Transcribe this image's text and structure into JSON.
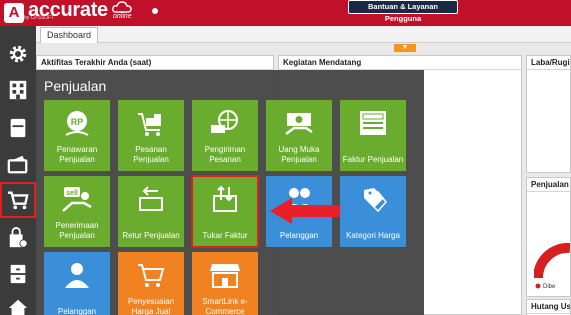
{
  "app": {
    "brand": "accurate",
    "brand_sub": "by CPSSOFT",
    "brand_edition": "online",
    "help_button": "Bantuan & Layanan Pengguna"
  },
  "tabs": [
    {
      "label": "Dashboard"
    }
  ],
  "panels": {
    "activity": "Aktifitas Terakhir Anda (saat)",
    "upcoming": "Kegiatan Mendatang",
    "profit_loss": "Laba/Rugi",
    "sales": "Penjualan",
    "receivables": "Hutang Us"
  },
  "menu": {
    "title": "Penjualan",
    "tiles": [
      {
        "label": "Penawaran Penjualan",
        "color": "green",
        "icon": "quotation-icon"
      },
      {
        "label": "Pesanan Penjualan",
        "color": "green",
        "icon": "cart-order-icon"
      },
      {
        "label": "Pengiriman Pesanan",
        "color": "green",
        "icon": "delivery-globe-icon"
      },
      {
        "label": "Uang Muka Penjualan",
        "color": "green",
        "icon": "down-payment-icon"
      },
      {
        "label": "Faktur Penjualan",
        "color": "green",
        "icon": "sales-invoice-icon"
      },
      {
        "label": "Penerimaan Penjualan",
        "color": "green",
        "icon": "sales-receipt-icon"
      },
      {
        "label": "Retur Penjualan",
        "color": "green",
        "icon": "return-icon"
      },
      {
        "label": "Tukar Faktur",
        "color": "green",
        "icon": "invoice-exchange-icon"
      },
      {
        "label": "Pelanggan",
        "color": "blue",
        "icon": "customer-group-icon"
      },
      {
        "label": "Kategori Harga",
        "color": "blue",
        "icon": "price-tag-icon"
      },
      {
        "label": "Pelanggan",
        "color": "blue",
        "icon": "customer-icon"
      },
      {
        "label": "Penyesuaian Harga Jual",
        "color": "orange",
        "icon": "price-adjust-icon"
      },
      {
        "label": "SmartLink e-Commerce",
        "color": "orange",
        "icon": "store-icon"
      }
    ]
  },
  "chart_partial": {
    "label": "Dibe"
  },
  "colors": {
    "brand_red": "#c0102a",
    "tile_green": "#6aac2e",
    "tile_blue": "#3a8fd8",
    "tile_orange": "#f08221",
    "highlight_red": "#e02020"
  }
}
